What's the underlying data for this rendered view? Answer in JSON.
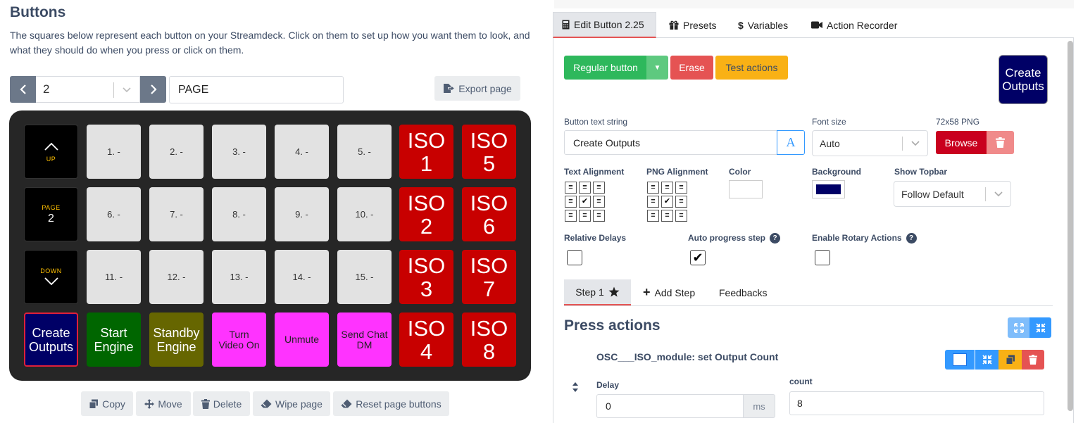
{
  "left": {
    "title": "Buttons",
    "description": "The squares below represent each button on your Streamdeck. Click on them to set up how you want them to look, and what they should do when you press or click on them.",
    "page_number": "2",
    "page_name": "PAGE",
    "export_label": "Export page",
    "nav_keys": {
      "up": "UP",
      "page": "PAGE",
      "page_num": "2",
      "down": "DOWN"
    },
    "blank_keys": [
      "1. -",
      "2. -",
      "3. -",
      "4. -",
      "5. -",
      "6. -",
      "7. -",
      "8. -",
      "9. -",
      "10. -",
      "11. -",
      "12. -",
      "13. -",
      "14. -",
      "15. -"
    ],
    "iso_keys": [
      {
        "line1": "ISO",
        "line2": "1"
      },
      {
        "line1": "ISO",
        "line2": "5"
      },
      {
        "line1": "ISO",
        "line2": "2"
      },
      {
        "line1": "ISO",
        "line2": "6"
      },
      {
        "line1": "ISO",
        "line2": "3"
      },
      {
        "line1": "ISO",
        "line2": "7"
      },
      {
        "line1": "ISO",
        "line2": "4"
      },
      {
        "line1": "ISO",
        "line2": "8"
      }
    ],
    "bottom_keys": {
      "create": {
        "line1": "Create",
        "line2": "Outputs"
      },
      "start": {
        "line1": "Start",
        "line2": "Engine"
      },
      "standby": {
        "line1": "Standby",
        "line2": "Engine"
      },
      "video": {
        "line1": "Turn",
        "line2": "Video On"
      },
      "unmute": "Unmute",
      "chat": {
        "line1": "Send Chat",
        "line2": "DM"
      }
    },
    "actions": {
      "copy": "Copy",
      "move": "Move",
      "delete": "Delete",
      "wipe": "Wipe page",
      "reset": "Reset page buttons"
    }
  },
  "right": {
    "tabs": {
      "edit": "Edit Button 2.25",
      "presets": "Presets",
      "variables": "Variables",
      "recorder": "Action Recorder"
    },
    "buttons": {
      "regular": "Regular button",
      "erase": "Erase",
      "test": "Test actions",
      "browse": "Browse"
    },
    "preview": {
      "line1": "Create",
      "line2": "Outputs"
    },
    "labels": {
      "text_string": "Button text string",
      "font_size": "Font size",
      "png": "72x58 PNG",
      "text_alignment": "Text Alignment",
      "png_alignment": "PNG Alignment",
      "color": "Color",
      "background": "Background",
      "show_topbar": "Show Topbar",
      "relative_delays": "Relative Delays",
      "auto_progress": "Auto progress step",
      "rotary": "Enable Rotary Actions"
    },
    "text_value": "Create Outputs",
    "font_size_value": "Auto",
    "topbar_value": "Follow Default",
    "colors": {
      "text_color": "#ffffff",
      "background": "#000066"
    },
    "checkboxes": {
      "relative_delays": false,
      "auto_progress": true,
      "rotary": false
    },
    "steps": {
      "step1": "Step 1",
      "add_step": "Add Step",
      "feedbacks": "Feedbacks"
    },
    "press_actions_title": "Press actions",
    "action": {
      "name": "OSC___ISO_module: set Output Count",
      "delay_label": "Delay",
      "delay_value": "0",
      "delay_unit": "ms",
      "count_label": "count",
      "count_value": "8"
    }
  }
}
